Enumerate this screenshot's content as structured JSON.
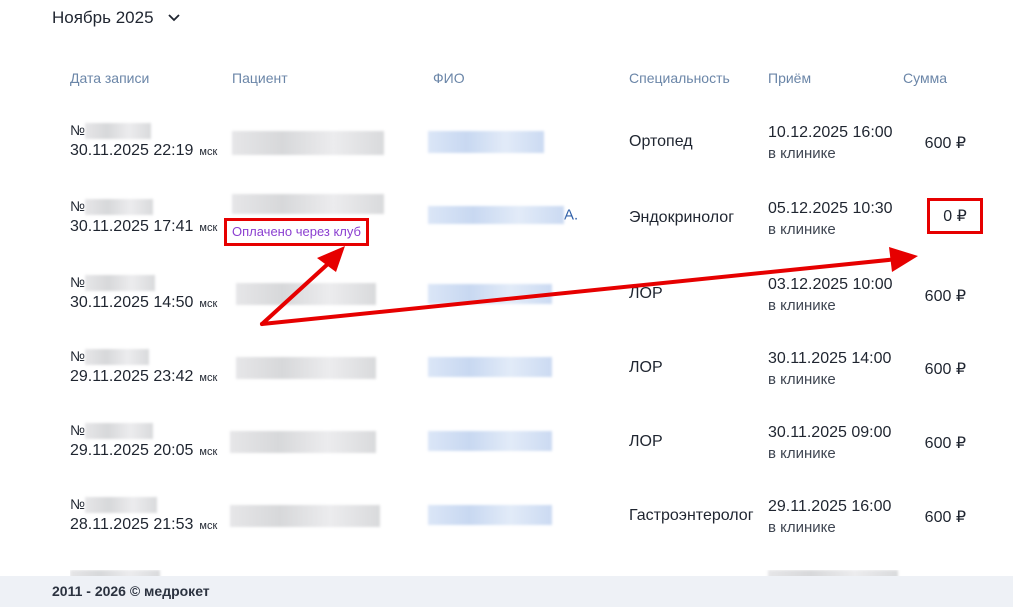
{
  "month_selector": {
    "label": "Ноябрь 2025"
  },
  "columns": [
    "Дата записи",
    "Пациент",
    "ФИО",
    "Специальность",
    "Приём",
    "Сумма"
  ],
  "rows": [
    {
      "num_prefix": "№",
      "date": "30.11.2025 22:19",
      "tz": "мск",
      "specialty": "Ортопед",
      "appt_time": "10.12.2025 16:00",
      "appt_place": "в клинике",
      "sum": "600 ₽"
    },
    {
      "num_prefix": "№",
      "date": "30.11.2025 17:41",
      "tz": "мск",
      "specialty": "Эндокринолог",
      "appt_time": "05.12.2025 10:30",
      "appt_place": "в клинике",
      "sum": "0 ₽",
      "fio_suffix": "А.",
      "badge": "Оплачено через клуб"
    },
    {
      "num_prefix": "№",
      "date": "30.11.2025 14:50",
      "tz": "мск",
      "specialty": "ЛОР",
      "appt_time": "03.12.2025 10:00",
      "appt_place": "в клинике",
      "sum": "600 ₽"
    },
    {
      "num_prefix": "№",
      "date": "29.11.2025 23:42",
      "tz": "мск",
      "specialty": "ЛОР",
      "appt_time": "30.11.2025 14:00",
      "appt_place": "в клинике",
      "sum": "600 ₽"
    },
    {
      "num_prefix": "№",
      "date": "29.11.2025 20:05",
      "tz": "мск",
      "specialty": "ЛОР",
      "appt_time": "30.11.2025 09:00",
      "appt_place": "в клинике",
      "sum": "600 ₽"
    },
    {
      "num_prefix": "№",
      "date": "28.11.2025 21:53",
      "tz": "мск",
      "specialty": "Гастроэнтеролог",
      "appt_time": "29.11.2025 16:00",
      "appt_place": "в клинике",
      "sum": "600 ₽"
    }
  ],
  "footer": {
    "text": "2011 - 2026 © медрокет"
  },
  "colors": {
    "accent_red": "#e60000",
    "badge_purple": "#8b3fd0",
    "header_blue": "#6b86a8"
  }
}
